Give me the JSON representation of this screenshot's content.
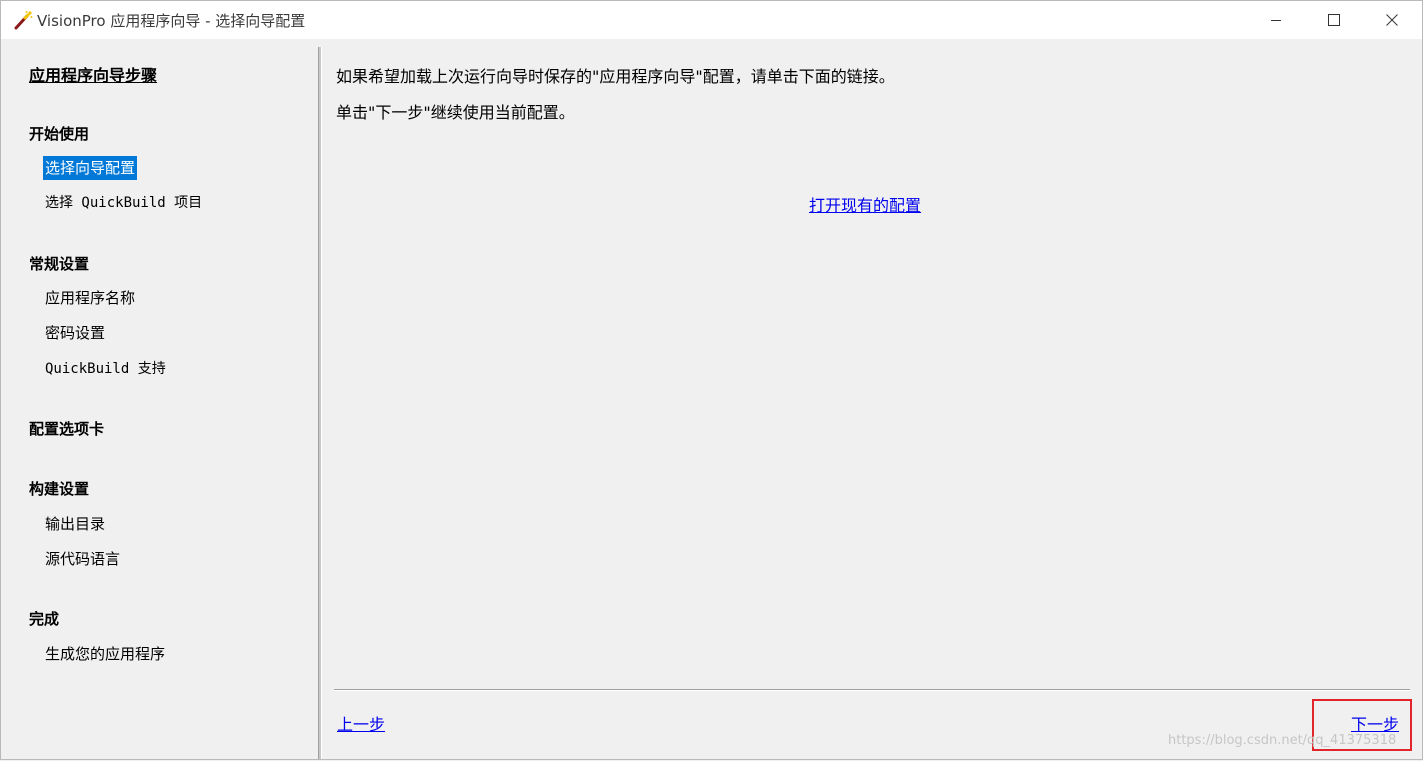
{
  "window": {
    "title": "VisionPro 应用程序向导 - 选择向导配置",
    "icon": "magic-wand-icon",
    "controls": {
      "minimize": "minimize-icon",
      "maximize": "maximize-icon",
      "close": "close-icon"
    }
  },
  "steps": {
    "heading": "应用程序向导步骤",
    "groups": [
      {
        "label": "开始使用",
        "items": [
          "选择向导配置",
          "选择 QuickBuild 项目"
        ]
      },
      {
        "label": "常规设置",
        "items": [
          "应用程序名称",
          "密码设置",
          "QuickBuild 支持"
        ]
      },
      {
        "label": "配置选项卡",
        "items": []
      },
      {
        "label": "构建设置",
        "items": [
          "输出目录",
          "源代码语言"
        ]
      },
      {
        "label": "完成",
        "items": [
          "生成您的应用程序"
        ]
      }
    ],
    "active_item": "选择向导配置"
  },
  "content": {
    "line1": "如果希望加载上次运行向导时保存的\"应用程序向导\"配置，请单击下面的链接。",
    "line2": "单击\"下一步\"继续使用当前配置。",
    "open_link": "打开现有的配置"
  },
  "footer": {
    "prev": "上一步",
    "next": "下一步"
  },
  "watermark": "https://blog.csdn.net/qq_41375318",
  "colors": {
    "selection": "#0078d7",
    "link": "#0000ee",
    "highlight_box": "#e2252b",
    "background": "#f0f0f0"
  }
}
